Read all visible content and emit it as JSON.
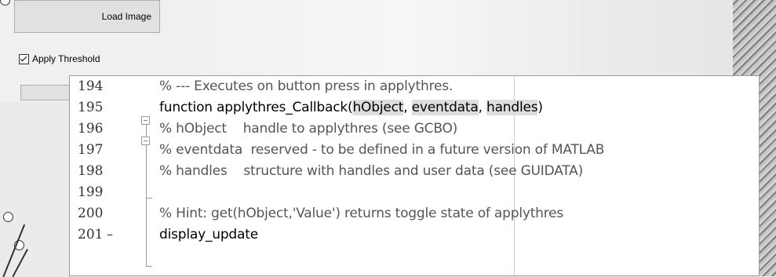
{
  "gui": {
    "load_image_label": "Load Image",
    "apply_threshold_label": "Apply Threshold",
    "apply_threshold_checked": true
  },
  "editor": {
    "lines": [
      {
        "num": "194",
        "text": "% --- Executes on button press in applythres."
      },
      {
        "num": "195",
        "text_parts": [
          "function applythres_Callback(",
          "hObject",
          ", ",
          "eventdata",
          ", ",
          "handles",
          ")"
        ]
      },
      {
        "num": "196",
        "text": "% hObject    handle to applythres (see GCBO)"
      },
      {
        "num": "197",
        "text": "% eventdata  reserved - to be defined in a future version of MATLAB"
      },
      {
        "num": "198",
        "text": "% handles    structure with handles and user data (see GUIDATA)"
      },
      {
        "num": "199",
        "text": ""
      },
      {
        "num": "200",
        "text": "% Hint: get(hObject,'Value') returns toggle state of applythres"
      },
      {
        "num": "201",
        "marker": "–",
        "text": "display_update"
      }
    ]
  }
}
